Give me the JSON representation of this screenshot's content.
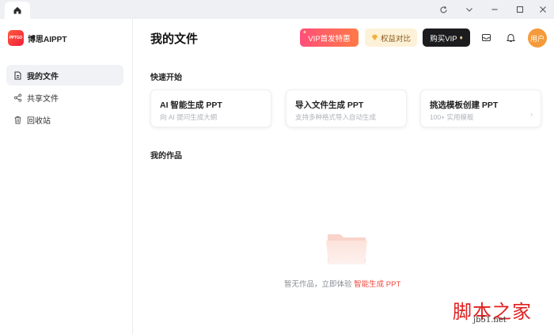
{
  "sidebar": {
    "brand": {
      "logo_text": "PPTGO",
      "name": "博思AIPPT"
    },
    "items": [
      {
        "label": "我的文件",
        "icon": "file-icon",
        "active": true
      },
      {
        "label": "共享文件",
        "icon": "share-icon",
        "active": false
      },
      {
        "label": "回收站",
        "icon": "trash-icon",
        "active": false
      }
    ]
  },
  "header": {
    "title": "我的文件",
    "vip_promo": "VIP首发特惠",
    "benefits": "权益对比",
    "buy_vip": "购买VIP",
    "avatar": "用户"
  },
  "quick_start": {
    "title": "快速开始",
    "cards": [
      {
        "title": "AI 智能生成 PPT",
        "subtitle": "向 AI 提问生成大纲"
      },
      {
        "title": "导入文件生成 PPT",
        "subtitle": "支持多种格式导入自动生成"
      },
      {
        "title": "挑选模板创建 PPT",
        "subtitle": "100+ 实用模板"
      }
    ]
  },
  "works": {
    "title": "我的作品",
    "empty_text": "暂无作品，立即体验",
    "empty_link": "智能生成 PPT"
  },
  "watermark": {
    "main": "脚本之家",
    "sub": "jb51.net"
  },
  "colors": {
    "accent": "#f0473c",
    "avatar": "#f59a3a",
    "buy_vip_bg": "#1c1c1f"
  }
}
